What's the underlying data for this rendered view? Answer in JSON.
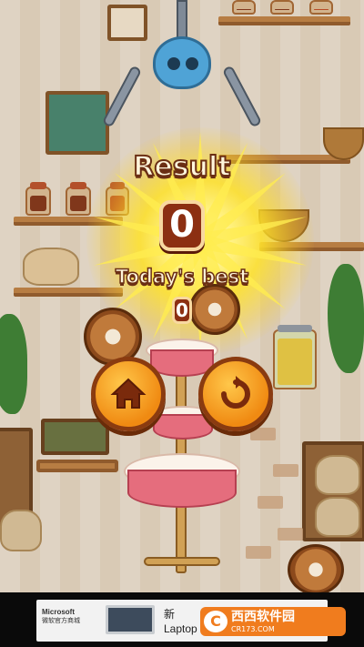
{
  "result_panel": {
    "title": "Result",
    "score": "0",
    "best_label": "Today's best",
    "best_score": "0"
  },
  "buttons": {
    "home_icon": "home-icon",
    "retry_icon": "retry-icon"
  },
  "ad_banner": {
    "brand_line1": "Microsoft",
    "brand_line2": "微软官方商城",
    "text_line1": "新",
    "text_line2": "Laptop 3 商用版"
  },
  "watermark": {
    "name": "西西软件园",
    "url": "CR173.COM",
    "logo_glyph": "C"
  },
  "colors": {
    "accent_orange": "#f08a12",
    "score_badge": "#8c2f12",
    "title_outline": "#6b2f14",
    "claw_blue": "#4fa3d6"
  }
}
